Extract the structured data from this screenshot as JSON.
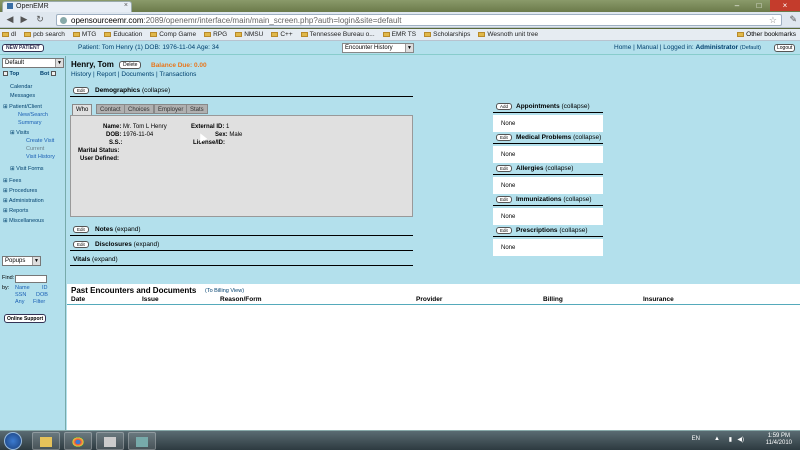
{
  "browser": {
    "tab_title": "OpenEMR",
    "url_host": "opensourceemr.com",
    "url_path": ":2089/openemr/interface/main/main_screen.php?auth=login&site=default",
    "bookmarks": [
      "dl",
      "pcb search",
      "MTG",
      "Education",
      "Comp Game",
      "RPG",
      "NMSU",
      "C++",
      "Tennessee Bureau o...",
      "EMR TS",
      "Scholarships",
      "Wesnoth unit tree"
    ],
    "other_bookmarks": "Other bookmarks"
  },
  "topbar": {
    "new_patient": "NEW PATIENT",
    "patient_info": "Patient: Tom Henry (1) DOB: 1976-11-04 Age: 34",
    "encounter_select": "Encounter History",
    "links": {
      "home": "Home",
      "manual": "Manual"
    },
    "logged_in": "Logged in:",
    "user": "Administrator",
    "user_site": "(Default)",
    "logout": "Logout"
  },
  "leftnav": {
    "facility": "Default",
    "top_label": "Top",
    "bot_label": "Bot",
    "items": [
      {
        "label": "Calendar",
        "kind": "main"
      },
      {
        "label": "Messages",
        "kind": "main"
      },
      {
        "label": "Patient/Client",
        "kind": "group"
      },
      {
        "label": "New/Search",
        "kind": "sub"
      },
      {
        "label": "Summary",
        "kind": "sub"
      },
      {
        "label": "Visits",
        "kind": "group2"
      },
      {
        "label": "Create Visit",
        "kind": "sub2"
      },
      {
        "label": "Current",
        "kind": "sub2grey"
      },
      {
        "label": "Visit History",
        "kind": "sub2"
      },
      {
        "label": "Visit Forms",
        "kind": "group2"
      },
      {
        "label": "Fees",
        "kind": "group"
      },
      {
        "label": "Procedures",
        "kind": "group"
      },
      {
        "label": "Administration",
        "kind": "group"
      },
      {
        "label": "Reports",
        "kind": "group"
      },
      {
        "label": "Miscellaneous",
        "kind": "group"
      }
    ],
    "popups": "Popups",
    "find_label": "Find:",
    "by_label": "by:",
    "find_options": [
      "Name",
      "ID",
      "SSN",
      "DOB",
      "Any",
      "Filter"
    ],
    "online_support": "Online Support"
  },
  "patient": {
    "name": "Henry, Tom",
    "delete": "Delete",
    "balance": "Balance Due: 0.00",
    "links": [
      "History",
      "Report",
      "Documents",
      "Transactions"
    ]
  },
  "demographics": {
    "edit": "Edit",
    "title": "Demographics",
    "toggle": "(collapse)",
    "tabs": [
      "Who",
      "Contact",
      "Choices",
      "Employer",
      "Stats"
    ],
    "fields": {
      "name_label": "Name:",
      "name_value": "Mr. Tom L Henry",
      "dob_label": "DOB:",
      "dob_value": "1976-11-04",
      "ss_label": "S.S.:",
      "marital_label": "Marital Status:",
      "userdef_label": "User Defined:",
      "extid_label": "External ID:",
      "extid_value": "1",
      "sex_label": "Sex:",
      "sex_value": "Male",
      "license_label": "License/ID:"
    }
  },
  "notes": {
    "edit": "Edit",
    "title": "Notes",
    "toggle": "(expand)"
  },
  "disclosures": {
    "edit": "Edit",
    "title": "Disclosures",
    "toggle": "(expand)"
  },
  "vitals": {
    "title": "Vitals",
    "toggle": "(expand)"
  },
  "right_sections": [
    {
      "btn": "Add",
      "title": "Appointments",
      "toggle": "(collapse)",
      "value": "None"
    },
    {
      "btn": "Edit",
      "title": "Medical Problems",
      "toggle": "(collapse)",
      "value": "None"
    },
    {
      "btn": "Edit",
      "title": "Allergies",
      "toggle": "(collapse)",
      "value": "None"
    },
    {
      "btn": "Edit",
      "title": "Immunizations",
      "toggle": "(collapse)",
      "value": "None"
    },
    {
      "btn": "Edit",
      "title": "Prescriptions",
      "toggle": "(collapse)",
      "value": "None"
    }
  ],
  "encounters": {
    "title": "Past Encounters and Documents",
    "billing_link": "(To Billing View)",
    "columns": [
      "Date",
      "Issue",
      "Reason/Form",
      "Provider",
      "Billing",
      "Insurance"
    ]
  },
  "taskbar": {
    "lang": "EN",
    "time": "1:59 PM",
    "date": "11/4/2010"
  }
}
